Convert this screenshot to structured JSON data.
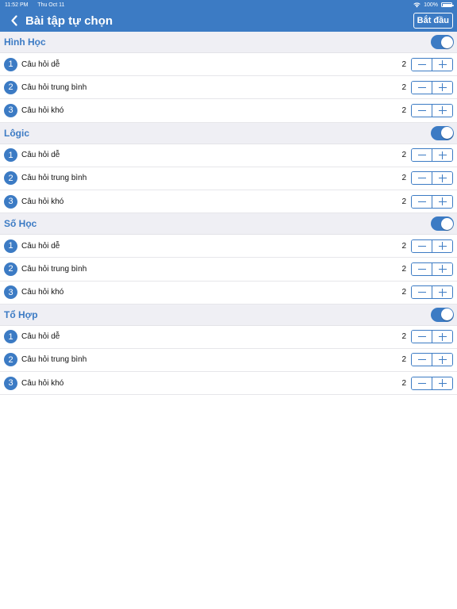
{
  "statusbar": {
    "time": "11:52 PM",
    "date": "Thu Oct 11",
    "battery": "100%"
  },
  "navbar": {
    "title": "Bài tập tự chọn",
    "start_label": "Bắt đầu"
  },
  "colors": {
    "accent": "#3c7bc4",
    "section_bg": "#efeff4"
  },
  "sections": [
    {
      "title": "Hình Học",
      "enabled": true,
      "rows": [
        {
          "num": "1",
          "label": "Câu hỏi dễ",
          "count": "2"
        },
        {
          "num": "2",
          "label": "Câu hỏi trung bình",
          "count": "2"
        },
        {
          "num": "3",
          "label": "Câu hỏi khó",
          "count": "2"
        }
      ]
    },
    {
      "title": "Lôgic",
      "enabled": true,
      "rows": [
        {
          "num": "1",
          "label": "Câu hỏi dễ",
          "count": "2"
        },
        {
          "num": "2",
          "label": "Câu hỏi trung bình",
          "count": "2"
        },
        {
          "num": "3",
          "label": "Câu hỏi khó",
          "count": "2"
        }
      ]
    },
    {
      "title": "Số Học",
      "enabled": true,
      "rows": [
        {
          "num": "1",
          "label": "Câu hỏi dễ",
          "count": "2"
        },
        {
          "num": "2",
          "label": "Câu hỏi trung bình",
          "count": "2"
        },
        {
          "num": "3",
          "label": "Câu hỏi khó",
          "count": "2"
        }
      ]
    },
    {
      "title": "Tổ Hợp",
      "enabled": true,
      "rows": [
        {
          "num": "1",
          "label": "Câu hỏi dễ",
          "count": "2"
        },
        {
          "num": "2",
          "label": "Câu hỏi trung bình",
          "count": "2"
        },
        {
          "num": "3",
          "label": "Câu hỏi khó",
          "count": "2"
        }
      ]
    }
  ]
}
